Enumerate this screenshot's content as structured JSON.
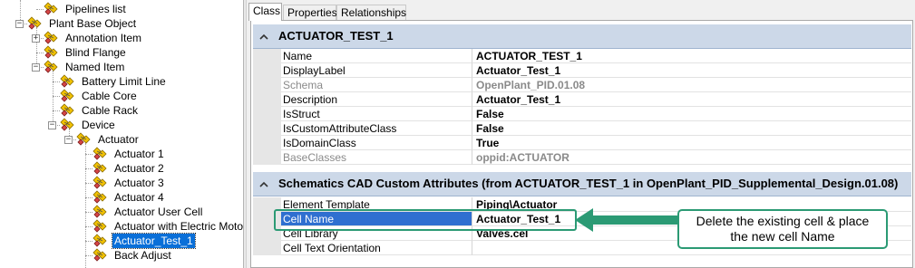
{
  "tree": {
    "items": [
      {
        "label": "Pipelines list",
        "level": 2,
        "expander": ""
      },
      {
        "label": "Plant Base Object",
        "level": 1,
        "expander": "-"
      },
      {
        "label": "Annotation Item",
        "level": 2,
        "expander": "+"
      },
      {
        "label": "Blind Flange",
        "level": 2,
        "expander": ""
      },
      {
        "label": "Named Item",
        "level": 2,
        "expander": "-"
      },
      {
        "label": "Battery Limit Line",
        "level": 3,
        "expander": ""
      },
      {
        "label": "Cable Core",
        "level": 3,
        "expander": ""
      },
      {
        "label": "Cable Rack",
        "level": 3,
        "expander": ""
      },
      {
        "label": "Device",
        "level": 3,
        "expander": "-"
      },
      {
        "label": "Actuator",
        "level": 4,
        "expander": "-"
      },
      {
        "label": "Actuator 1",
        "level": 5,
        "expander": ""
      },
      {
        "label": "Actuator 2",
        "level": 5,
        "expander": ""
      },
      {
        "label": "Actuator 3",
        "level": 5,
        "expander": ""
      },
      {
        "label": "Actuator 4",
        "level": 5,
        "expander": ""
      },
      {
        "label": "Actuator User Cell",
        "level": 5,
        "expander": ""
      },
      {
        "label": "Actuator with Electric Motor",
        "level": 5,
        "expander": ""
      },
      {
        "label": "Actuator_Test_1",
        "level": 5,
        "expander": "",
        "selected": true
      },
      {
        "label": "Back Adjust",
        "level": 5,
        "expander": ""
      }
    ]
  },
  "tabs": [
    {
      "label": "Class",
      "active": true
    },
    {
      "label": "Properties",
      "active": false
    },
    {
      "label": "Relationships",
      "active": false
    }
  ],
  "class_section": {
    "title": "ACTUATOR_TEST_1",
    "rows": [
      {
        "name": "Name",
        "value": "ACTUATOR_TEST_1",
        "disabled": false
      },
      {
        "name": "DisplayLabel",
        "value": "Actuator_Test_1",
        "disabled": false
      },
      {
        "name": "Schema",
        "value": "OpenPlant_PID.01.08",
        "disabled": true
      },
      {
        "name": "Description",
        "value": "Actuator_Test_1",
        "disabled": false
      },
      {
        "name": "IsStruct",
        "value": "False",
        "disabled": false
      },
      {
        "name": "IsCustomAttributeClass",
        "value": "False",
        "disabled": false
      },
      {
        "name": "IsDomainClass",
        "value": "True",
        "disabled": false
      },
      {
        "name": "BaseClasses",
        "value": "oppid:ACTUATOR",
        "disabled": true
      }
    ]
  },
  "custom_section": {
    "title": "Schematics CAD Custom Attributes (from ACTUATOR_TEST_1 in OpenPlant_PID_Supplemental_Design.01.08)",
    "rows": [
      {
        "name": "Element Template",
        "value": "Piping\\Actuator",
        "selected": false
      },
      {
        "name": "Cell Name",
        "value": "Actuator_Test_1",
        "selected": true
      },
      {
        "name": "Cell Library",
        "value": "Valves.cel",
        "selected": false
      },
      {
        "name": "Cell Text Orientation",
        "value": "",
        "selected": false
      }
    ]
  },
  "callout": {
    "line1": "Delete the existing cell & place",
    "line2": "the new cell Name"
  },
  "colors": {
    "accent_green": "#2b9a74",
    "selection_blue": "#2f6fd0",
    "section_header": "#ccd8e8"
  }
}
